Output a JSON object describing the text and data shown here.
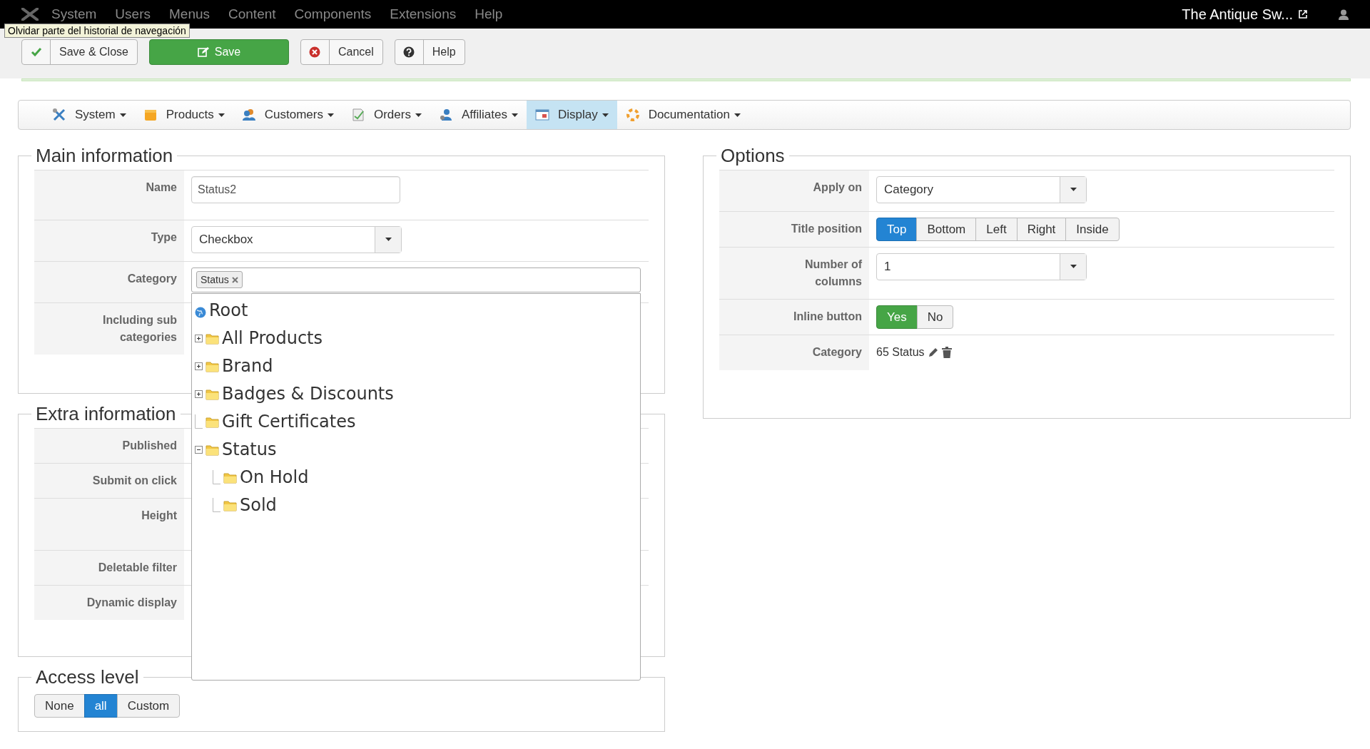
{
  "top_menu": [
    {
      "label": "System"
    },
    {
      "label": "Users"
    },
    {
      "label": "Menus"
    },
    {
      "label": "Content"
    },
    {
      "label": "Components"
    },
    {
      "label": "Extensions"
    },
    {
      "label": "Help"
    }
  ],
  "tooltip": "Olvidar parte del historial de navegación",
  "site_link": "The Antique Sw...",
  "toolbar": [
    {
      "label": "Save & Close",
      "kind": "check"
    },
    {
      "label": "Save",
      "kind": "save"
    },
    {
      "label": "Cancel",
      "kind": "cancel"
    },
    {
      "label": "Help",
      "kind": "help"
    }
  ],
  "nav": [
    {
      "label": "System",
      "kind": "tools",
      "selected": false
    },
    {
      "label": "Products",
      "kind": "box",
      "selected": false
    },
    {
      "label": "Customers",
      "kind": "people",
      "selected": false
    },
    {
      "label": "Orders",
      "kind": "doc",
      "selected": false
    },
    {
      "label": "Affiliates",
      "kind": "person",
      "selected": false
    },
    {
      "label": "Display",
      "kind": "window",
      "selected": true
    },
    {
      "label": "Documentation",
      "kind": "ring",
      "selected": false
    }
  ],
  "main_information": {
    "title": "Main information",
    "rows": [
      {
        "label": "Name",
        "kind": "text",
        "value": "Status2"
      },
      {
        "label": "Type",
        "kind": "select",
        "value": "Checkbox"
      },
      {
        "label": "Category",
        "kind": "tags",
        "tags": [
          "Status"
        ]
      },
      {
        "label": "Including sub categories",
        "kind": "empty"
      }
    ]
  },
  "category_tree": {
    "label": "Root",
    "children": [
      {
        "label": "All Products",
        "kind": "plus"
      },
      {
        "label": "Brand",
        "kind": "plus"
      },
      {
        "label": "Badges & Discounts",
        "kind": "plus"
      },
      {
        "label": "Gift Certificates",
        "kind": "leaf"
      },
      {
        "label": "Status",
        "kind": "minus",
        "children": [
          {
            "label": "On Hold",
            "kind": "leaf"
          },
          {
            "label": "Sold",
            "kind": "leaf"
          }
        ]
      }
    ]
  },
  "extra_information": {
    "title": "Extra information",
    "rows": [
      {
        "label": "Published"
      },
      {
        "label": "Submit on click"
      },
      {
        "label": "Height",
        "kind": "tall"
      },
      {
        "label": "Deletable filter"
      },
      {
        "label": "Dynamic display"
      }
    ]
  },
  "access_level": {
    "title": "Access level",
    "options": [
      {
        "label": "None",
        "selected": false
      },
      {
        "label": "all",
        "selected": true
      },
      {
        "label": "Custom",
        "selected": false
      }
    ]
  },
  "options": {
    "title": "Options",
    "rows": [
      {
        "label": "Apply on",
        "kind": "select",
        "value": "Category"
      },
      {
        "label": "Title position",
        "kind": "choice",
        "options": [
          {
            "label": "Top",
            "selected": true
          },
          {
            "label": "Bottom",
            "selected": false
          },
          {
            "label": "Left",
            "selected": false
          },
          {
            "label": "Right",
            "selected": false
          },
          {
            "label": "Inside",
            "selected": false
          }
        ]
      },
      {
        "label": "Number of columns",
        "kind": "select",
        "value": "1"
      },
      {
        "label": "Inline button",
        "kind": "toggle",
        "options": [
          {
            "label": "Yes",
            "selected": true
          },
          {
            "label": "No",
            "selected": false
          }
        ]
      },
      {
        "label": "Category",
        "kind": "edit_text",
        "value": "65 Status"
      }
    ]
  }
}
